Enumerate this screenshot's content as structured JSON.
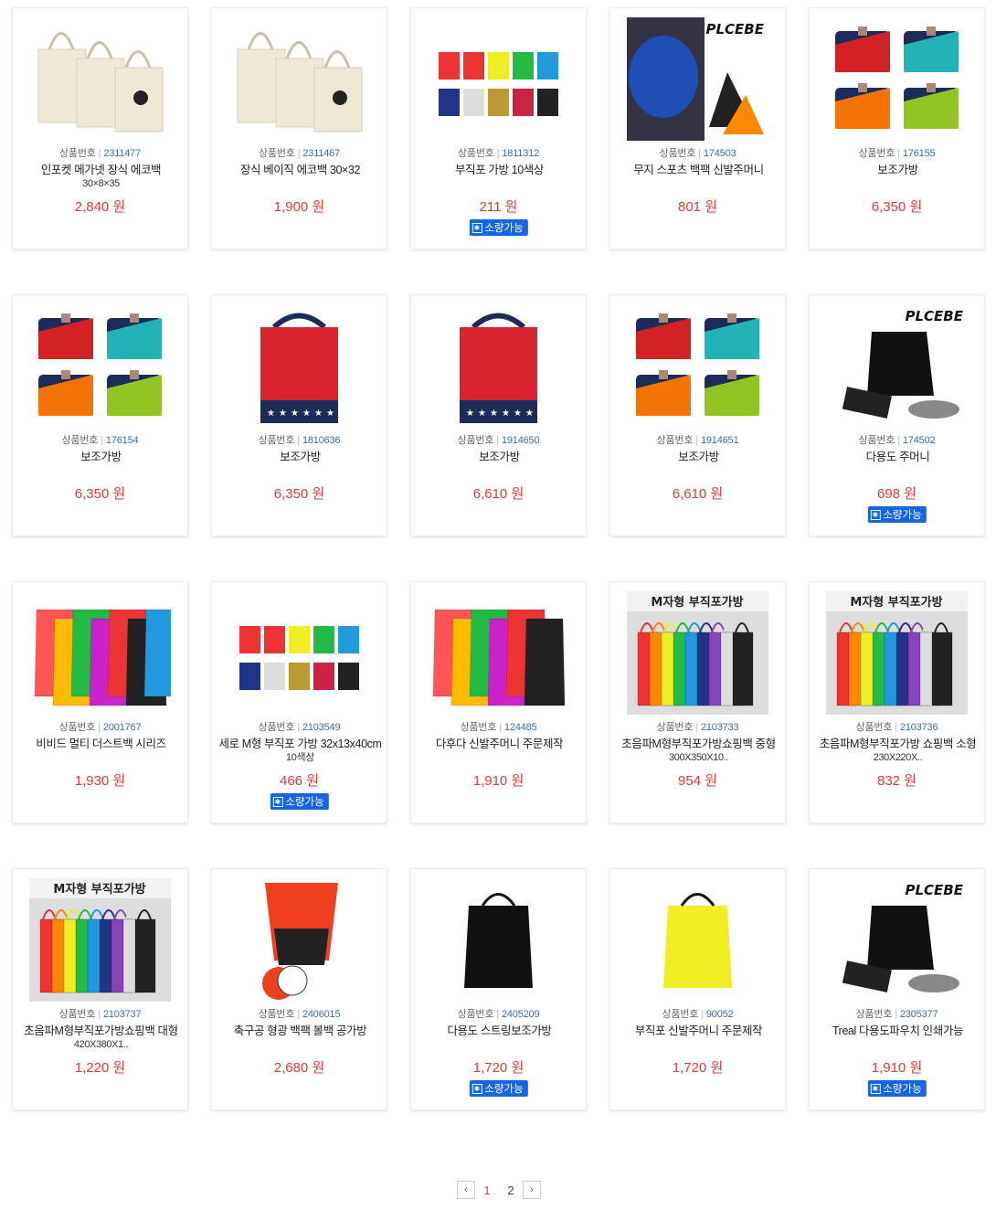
{
  "labels": {
    "product_no": "상품번호",
    "won": "원",
    "badge": "소량가능"
  },
  "products": [
    {
      "no": "2311477",
      "name": "인포켓 메가넷 장식 에코백",
      "sub": "30×8×35",
      "price": "2,840",
      "badge": false,
      "img": "canvas-bag-icon"
    },
    {
      "no": "2311467",
      "name": "장식 베이직 에코백 30×32",
      "sub": "",
      "price": "1,900",
      "badge": false,
      "img": "canvas-bag-icon"
    },
    {
      "no": "1811312",
      "name": "부직포 가방 10색상",
      "sub": "",
      "price": "211",
      "badge": true,
      "img": "nonwoven-bag-icon"
    },
    {
      "no": "174503",
      "name": "무지 스포츠 백팩 신발주머니",
      "sub": "",
      "price": "801",
      "badge": false,
      "img": "drawstring-backpack-icon"
    },
    {
      "no": "176155",
      "name": "보조가방",
      "sub": "",
      "price": "6,350",
      "badge": false,
      "img": "sub-bag-icon"
    },
    {
      "no": "176154",
      "name": "보조가방",
      "sub": "",
      "price": "6,350",
      "badge": false,
      "img": "sub-bag-icon"
    },
    {
      "no": "1810636",
      "name": "보조가방",
      "sub": "",
      "price": "6,350",
      "badge": false,
      "img": "tote-bag-icon"
    },
    {
      "no": "1914650",
      "name": "보조가방",
      "sub": "",
      "price": "6,610",
      "badge": false,
      "img": "tote-bag-icon"
    },
    {
      "no": "1914651",
      "name": "보조가방",
      "sub": "",
      "price": "6,610",
      "badge": false,
      "img": "sub-bag-icon"
    },
    {
      "no": "174502",
      "name": "다용도 주머니",
      "sub": "",
      "price": "698",
      "badge": true,
      "img": "pouch-icon"
    },
    {
      "no": "2001767",
      "name": "비비드 멀티 더스트백 시리즈",
      "sub": "",
      "price": "1,930",
      "badge": false,
      "img": "drawstring-bag-icon"
    },
    {
      "no": "2103549",
      "name": "세로 M형 부직포 가방 32x13x40cm",
      "sub": "10색상",
      "price": "466",
      "badge": true,
      "img": "nonwoven-bag-icon"
    },
    {
      "no": "124485",
      "name": "다후다 신발주머니 주문제작",
      "sub": "",
      "price": "1,910",
      "badge": false,
      "img": "drawstring-bag-icon"
    },
    {
      "no": "2103733",
      "name": "초음파M형부직포가방쇼핑백 중형",
      "sub": "300X350X10..",
      "price": "954",
      "badge": false,
      "img": "nonwoven-shopping-bag-icon"
    },
    {
      "no": "2103736",
      "name": "초음파M형부직포가방 쇼핑백 소형",
      "sub": "230X220X..",
      "price": "832",
      "badge": false,
      "img": "nonwoven-shopping-bag-icon"
    },
    {
      "no": "2103737",
      "name": "초음파M형부직포가방쇼핑백 대형",
      "sub": "420X380X1..",
      "price": "1,220",
      "badge": false,
      "img": "nonwoven-shopping-bag-icon"
    },
    {
      "no": "2406015",
      "name": "축구공 형광 백팩 볼백 공가방",
      "sub": "",
      "price": "2,680",
      "badge": false,
      "img": "ball-bag-icon"
    },
    {
      "no": "2405209",
      "name": "다용도 스트링보조가방",
      "sub": "",
      "price": "1,720",
      "badge": true,
      "img": "drawstring-bag-icon"
    },
    {
      "no": "90052",
      "name": "부직포 신발주머니 주문제작",
      "sub": "",
      "price": "1,720",
      "badge": false,
      "img": "drawstring-bag-icon"
    },
    {
      "no": "2305377",
      "name": "Treal 다용도파우치 인쇄가능",
      "sub": "",
      "price": "1,910",
      "badge": true,
      "img": "pouch-icon"
    }
  ],
  "banners": {
    "m_bag": "M자형 부직포가방",
    "plcebe": "PLCEBE"
  },
  "pagination": {
    "prev": "‹",
    "next": "›",
    "pages": [
      "1",
      "2"
    ],
    "current": "1"
  },
  "colors": {
    "price": "#e03a3a",
    "badge": "#1565e6",
    "number": "#3a6ea5"
  }
}
